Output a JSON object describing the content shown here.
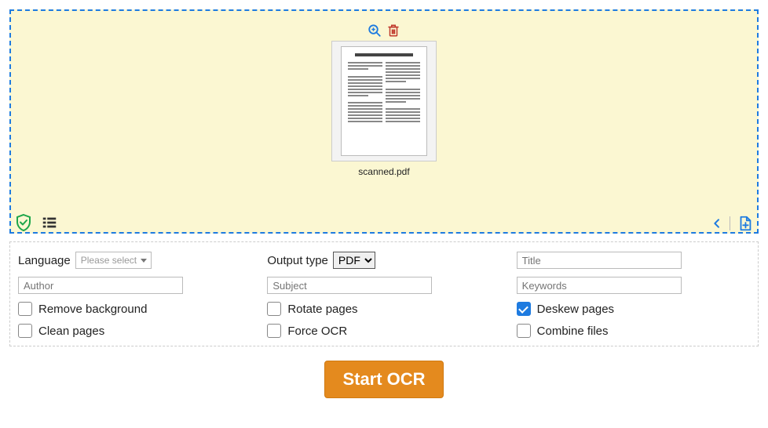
{
  "dropzone": {
    "file_name": "scanned.pdf"
  },
  "options": {
    "language_label": "Language",
    "language_placeholder": "Please select",
    "output_type_label": "Output type",
    "output_type_value": "PDF",
    "title_placeholder": "Title",
    "author_placeholder": "Author",
    "subject_placeholder": "Subject",
    "keywords_placeholder": "Keywords",
    "checks": {
      "remove_background": {
        "label": "Remove background",
        "checked": false
      },
      "clean_pages": {
        "label": "Clean pages",
        "checked": false
      },
      "rotate_pages": {
        "label": "Rotate pages",
        "checked": false
      },
      "force_ocr": {
        "label": "Force OCR",
        "checked": false
      },
      "deskew_pages": {
        "label": "Deskew pages",
        "checked": true
      },
      "combine_files": {
        "label": "Combine files",
        "checked": false
      }
    }
  },
  "actions": {
    "start_label": "Start OCR"
  },
  "colors": {
    "accent_blue": "#1e7be0",
    "accent_orange": "#e48a1e",
    "delete_red": "#c0392b",
    "shield_green": "#1da64a"
  }
}
